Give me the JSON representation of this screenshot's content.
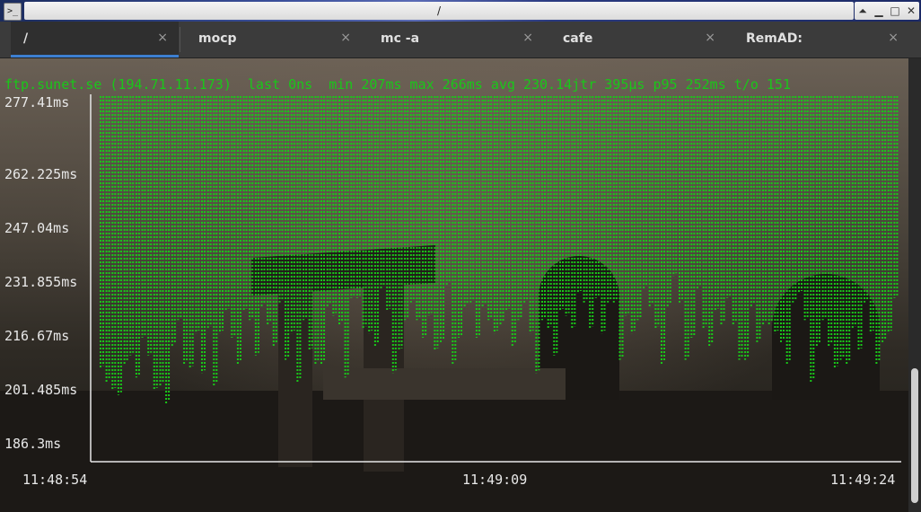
{
  "window": {
    "title": "/"
  },
  "window_controls": {
    "shade": "⏶",
    "minimize": "▁",
    "maximize": "□",
    "close": "✕"
  },
  "app_icon": ">_",
  "tabs": [
    {
      "label": "/",
      "close": "×",
      "active": true
    },
    {
      "label": "mocp",
      "close": "×",
      "active": false
    },
    {
      "label": "mc -a",
      "close": "×",
      "active": false
    },
    {
      "label": "cafe",
      "close": "×",
      "active": false
    },
    {
      "label": "RemAD:",
      "close": "×",
      "active": false
    }
  ],
  "terminal": {
    "stats_line": "ftp.sunet.se (194.71.11.173)  last 0ns  min 207ms max 266ms avg 230.14jtr 395µs p95 252ms t/o 151",
    "text_color": "#19c819",
    "label_color": "#e8e8e8"
  },
  "chart_data": {
    "type": "bar",
    "title": "",
    "y_tick_labels": [
      "277.41ms",
      "262.225ms",
      "247.04ms",
      "231.855ms",
      "216.67ms",
      "201.485ms",
      "186.3ms"
    ],
    "x_tick_labels": [
      "11:48:54",
      "11:49:09",
      "11:49:24"
    ],
    "ylim": [
      186.3,
      277.41
    ],
    "values": [
      217,
      214,
      212,
      211,
      218,
      220,
      215,
      224,
      220,
      212,
      213,
      209,
      222,
      228,
      218,
      217,
      225,
      216,
      226,
      213,
      225,
      230,
      224,
      218,
      230,
      228,
      220,
      231,
      227,
      222,
      232,
      219,
      225,
      214,
      228,
      221,
      218,
      218,
      231,
      229,
      227,
      215,
      233,
      233,
      226,
      225,
      222,
      235,
      230,
      216,
      221,
      228,
      232,
      228,
      224,
      229,
      221,
      223,
      236,
      218,
      224,
      231,
      232,
      224,
      231,
      228,
      225,
      227,
      230,
      222,
      228,
      232,
      225,
      216,
      228,
      226,
      220,
      230,
      229,
      226,
      234,
      232,
      226,
      233,
      225,
      232,
      232,
      219,
      229,
      225,
      228,
      235,
      231,
      226,
      218,
      231,
      238,
      232,
      219,
      224,
      235,
      226,
      222,
      230,
      227,
      233,
      227,
      219,
      219,
      231,
      223,
      227,
      227,
      225,
      223,
      218,
      232,
      234,
      228,
      214,
      222,
      228,
      222,
      217,
      219,
      218,
      226,
      221,
      232,
      225,
      218,
      223,
      225,
      233
    ],
    "series_color": "#19c819",
    "grid": false
  }
}
